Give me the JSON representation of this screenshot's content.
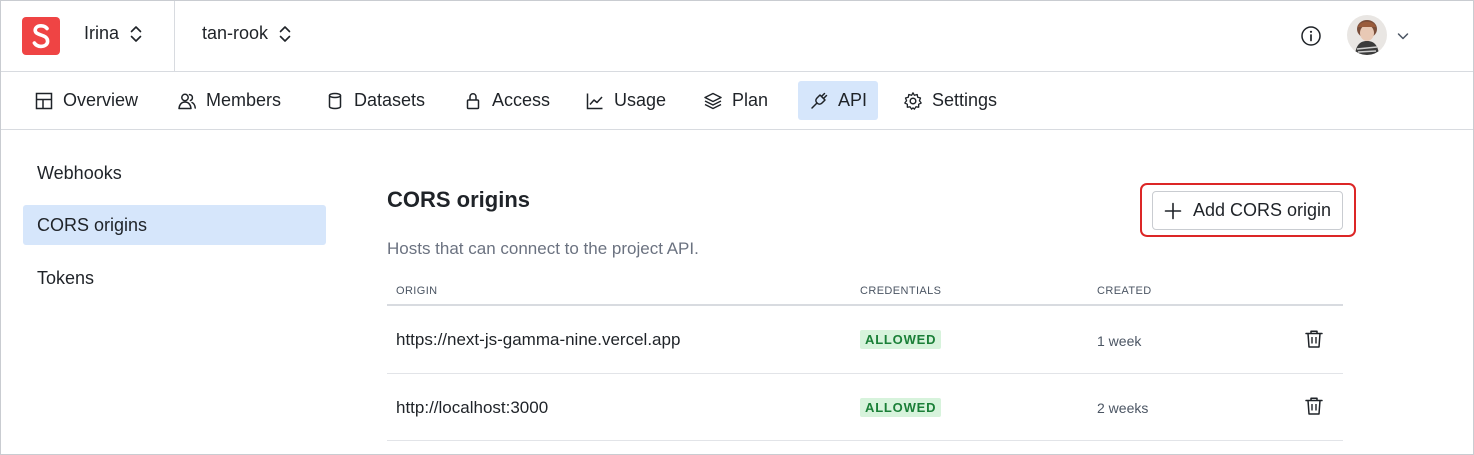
{
  "brand": {
    "logo_letter": "S",
    "logo_color": "#ef4444"
  },
  "header": {
    "org_name": "Irina",
    "project_name": "tan-rook",
    "info_icon": "info-icon",
    "avatar": "user-avatar"
  },
  "tabs": [
    {
      "label": "Overview",
      "icon": "layout-grid-icon",
      "active": false
    },
    {
      "label": "Members",
      "icon": "users-icon",
      "active": false
    },
    {
      "label": "Datasets",
      "icon": "database-icon",
      "active": false
    },
    {
      "label": "Access",
      "icon": "lock-icon",
      "active": false
    },
    {
      "label": "Usage",
      "icon": "chart-line-icon",
      "active": false
    },
    {
      "label": "Plan",
      "icon": "layers-icon",
      "active": false
    },
    {
      "label": "API",
      "icon": "plug-icon",
      "active": true
    },
    {
      "label": "Settings",
      "icon": "gear-icon",
      "active": false
    }
  ],
  "sidebar": {
    "items": [
      {
        "label": "Webhooks",
        "active": false
      },
      {
        "label": "CORS origins",
        "active": true
      },
      {
        "label": "Tokens",
        "active": false
      }
    ]
  },
  "main": {
    "title": "CORS origins",
    "subtitle": "Hosts that can connect to the project API.",
    "add_button_label": "Add CORS origin",
    "table": {
      "headers": [
        "ORIGIN",
        "CREDENTIALS",
        "CREATED"
      ],
      "rows": [
        {
          "origin": "https://next-js-gamma-nine.vercel.app",
          "credentials": "ALLOWED",
          "created": "1 week"
        },
        {
          "origin": "http://localhost:3000",
          "credentials": "ALLOWED",
          "created": "2 weeks"
        }
      ]
    }
  },
  "colors": {
    "accent_bg": "#d6e6fb",
    "badge_bg": "#d7f3dc",
    "badge_text": "#1a7f37",
    "highlight": "#dc2626"
  }
}
